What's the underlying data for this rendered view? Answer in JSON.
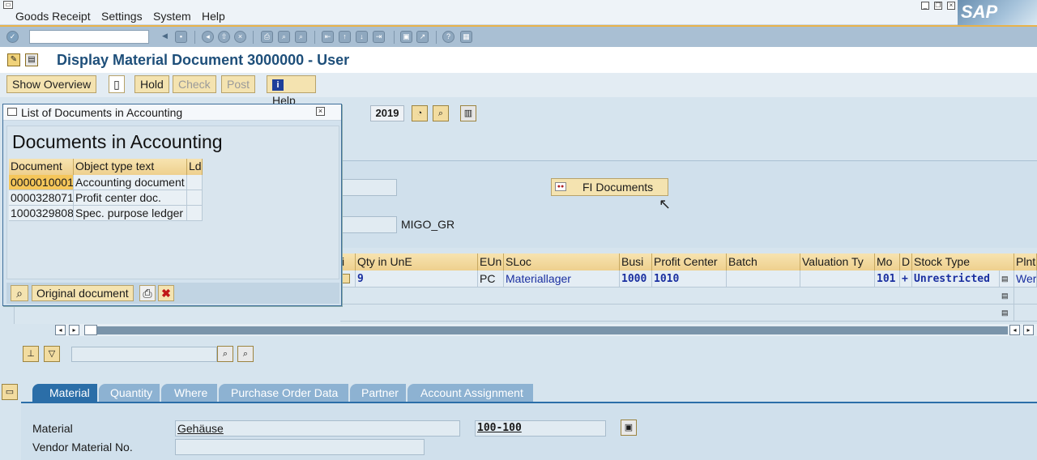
{
  "menu": [
    "Goods Receipt",
    "Settings",
    "System",
    "Help"
  ],
  "logo_text": "SAP",
  "title": "Display Material Document 3000000 - User",
  "app_toolbar": {
    "show_overview": "Show Overview",
    "hold": "Hold",
    "check": "Check",
    "post": "Post",
    "help": "Help"
  },
  "year": "2019",
  "fi_documents_button": "FI Documents",
  "header_value": "MIGO_GR",
  "grid": {
    "headers": [
      "i",
      "Qty in UnE",
      "EUn",
      "SLoc",
      "Busi",
      "Profit Center",
      "Batch",
      "Valuation Ty",
      "Mo",
      "D",
      "Stock Type",
      "Plnt"
    ],
    "row1": {
      "qty": "9",
      "eun": "PC",
      "sloc": "Materiallager",
      "busi": "1000",
      "profit_center": "1010",
      "mo": "101",
      "d": "+",
      "stock_type": "Unrestricted",
      "plnt": "Wer"
    }
  },
  "tabs": [
    "Material",
    "Quantity",
    "Where",
    "Purchase Order Data",
    "Partner",
    "Account Assignment"
  ],
  "detail": {
    "material_label": "Material",
    "material_desc": "Gehäuse",
    "material_no": "100-100",
    "vendor_material_label": "Vendor Material No."
  },
  "popup": {
    "title": "List of Documents in Accounting",
    "heading": "Documents in Accounting",
    "columns": [
      "Document",
      "Object type text",
      "Ld"
    ],
    "rows": [
      {
        "document": "0000010001",
        "type": "Accounting document"
      },
      {
        "document": "0000328071",
        "type": "Profit center doc."
      },
      {
        "document": "1000329808",
        "type": "Spec. purpose ledger"
      }
    ],
    "original_document_button": "Original document"
  },
  "colors": {
    "title": "#1e4f7a",
    "active_tab": "#2b6ea8",
    "button_fill": "#f4e3b0",
    "selected_cell": "#f5c65a"
  }
}
